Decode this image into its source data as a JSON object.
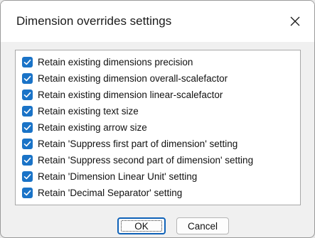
{
  "dialog": {
    "title": "Dimension overrides settings",
    "close_icon": "close-icon"
  },
  "options": [
    {
      "label": "Retain existing dimensions precision",
      "checked": true
    },
    {
      "label": "Retain existing dimension overall-scalefactor",
      "checked": true
    },
    {
      "label": "Retain existing dimension linear-scalefactor",
      "checked": true
    },
    {
      "label": "Retain existing text size",
      "checked": true
    },
    {
      "label": "Retain existing arrow size",
      "checked": true
    },
    {
      "label": "Retain 'Suppress first part of dimension' setting",
      "checked": true
    },
    {
      "label": "Retain 'Suppress second part of dimension' setting",
      "checked": true
    },
    {
      "label": "Retain 'Dimension Linear Unit' setting",
      "checked": true
    },
    {
      "label": "Retain 'Decimal Separator' setting",
      "checked": true
    }
  ],
  "buttons": {
    "ok_label": "OK",
    "cancel_label": "Cancel"
  },
  "colors": {
    "checkbox_accent": "#1a73c7",
    "default_button_border": "#0f62b8"
  }
}
